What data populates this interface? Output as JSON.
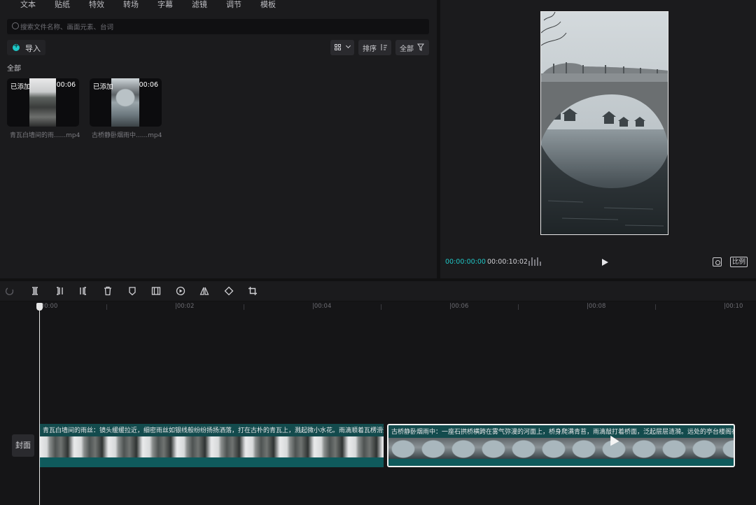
{
  "top_tabs": [
    "文本",
    "贴纸",
    "特效",
    "转场",
    "字幕",
    "滤镜",
    "调节",
    "模板"
  ],
  "media": {
    "search_placeholder": "搜索文件名称、画面元素、台词",
    "import_label": "导入",
    "sort_label": "排序",
    "filter_label": "全部",
    "section_label": "全部",
    "items": [
      {
        "added": "已添加",
        "duration": "00:06",
        "filename": "青瓦白墙间的雨......mp4"
      },
      {
        "added": "已添加",
        "duration": "00:06",
        "filename": "古桥静卧烟雨中......mp4"
      }
    ]
  },
  "preview": {
    "time_current": "00:00:00:00",
    "time_total": "00:00:10:02",
    "ratio_label": "比例"
  },
  "timeline": {
    "ruler_labels": [
      "|00:00",
      "|00:02",
      "|00:04",
      "|00:06",
      "|00:08",
      "|00:10"
    ],
    "cover_label": "封面",
    "clips": [
      {
        "caption": "青瓦白墙间的雨丝：镜头缓缓拉近，细密雨丝如银线般纷纷扬扬洒落，打在古朴的青瓦上，溅起微小水花。雨滴顺着瓦楞滑落，形"
      },
      {
        "caption": "古桥静卧烟雨中：一座石拱桥横跨在雾气弥漫的河面上，桥身爬满青苔，雨滴敲打着桥面，泛起层层涟漪。远处的亭台楼阁在烟雨"
      }
    ]
  },
  "colors": {
    "accent": "#1ec8c8",
    "clip": "#134b4d",
    "panel": "#1b1b1d"
  }
}
